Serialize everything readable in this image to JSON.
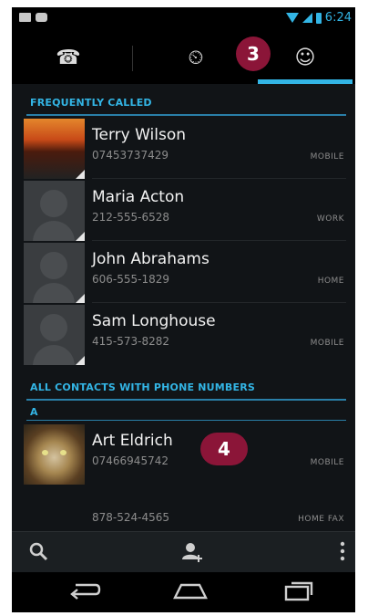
{
  "status_bar": {
    "time": "6:24",
    "icons": [
      "mail-icon",
      "voicemail-icon",
      "wifi-icon",
      "signal-icon",
      "battery-icon"
    ]
  },
  "tabs": [
    {
      "name": "phone",
      "icon": "phone-icon",
      "glyph": "☎"
    },
    {
      "name": "recent",
      "icon": "clock-icon",
      "glyph": "⏲"
    },
    {
      "name": "contacts",
      "icon": "contacts-icon",
      "glyph": "☺",
      "selected": true
    }
  ],
  "callouts": {
    "step_tab": "3",
    "step_contact": "4"
  },
  "sections": {
    "frequent": "FREQUENTLY CALLED",
    "all": "ALL CONTACTS WITH PHONE NUMBERS",
    "letter": "A"
  },
  "frequent": [
    {
      "name": "Terry Wilson",
      "phone": "07453737429",
      "type": "MOBILE",
      "thumb": "sunset"
    },
    {
      "name": "Maria Acton",
      "phone": "212-555-6528",
      "type": "WORK",
      "thumb": "silhouette"
    },
    {
      "name": "John Abrahams",
      "phone": "606-555-1829",
      "type": "HOME",
      "thumb": "silhouette"
    },
    {
      "name": "Sam Longhouse",
      "phone": "415-573-8282",
      "type": "MOBILE",
      "thumb": "silhouette"
    }
  ],
  "contacts": [
    {
      "name": "Art Eldrich",
      "phone": "07466945742",
      "type": "MOBILE",
      "thumb": "cat"
    },
    {
      "name": "",
      "phone": "878-524-4565",
      "type": "HOME FAX",
      "thumb": "none"
    }
  ],
  "action_bar": [
    "search-icon",
    "add-contact-icon",
    "overflow-menu-icon"
  ],
  "nav_bar": [
    "back-icon",
    "home-icon",
    "recent-apps-icon"
  ],
  "colors": {
    "accent": "#33b5e5",
    "callout": "#8b1538",
    "background": "#111417"
  }
}
